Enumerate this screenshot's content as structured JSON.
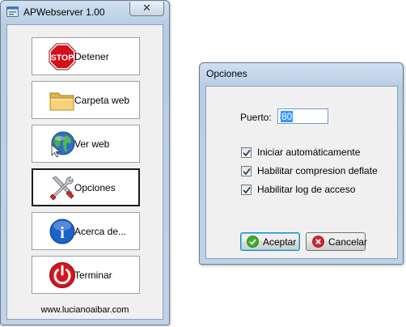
{
  "main_window": {
    "title": "APWebserver 1.00",
    "close_glyph": "✕",
    "buttons": [
      {
        "label": "Detener",
        "icon": "stop-sign-icon"
      },
      {
        "label": "Carpeta web",
        "icon": "folder-icon"
      },
      {
        "label": "Ver web",
        "icon": "globe-icon"
      },
      {
        "label": "Opciones",
        "icon": "tools-icon"
      },
      {
        "label": "Acerca de...",
        "icon": "info-icon"
      },
      {
        "label": "Terminar",
        "icon": "power-icon"
      }
    ],
    "stop_sign_text": "STOP",
    "info_glyph": "i",
    "website": "www.lucianoaibar.com"
  },
  "options_dialog": {
    "title": "Opciones",
    "port_label": "Puerto:",
    "port_value": "80",
    "checkboxes": [
      {
        "label": "Iniciar automáticamente",
        "checked": true
      },
      {
        "label": "Habilitar compresion deflate",
        "checked": true
      },
      {
        "label": "Habilitar log de acceso",
        "checked": true
      }
    ],
    "accept_label": "Aceptar",
    "cancel_label": "Cancelar"
  },
  "colors": {
    "frame": "#bfd3e8",
    "stop_red": "#d4101a",
    "globe_blue": "#2f6fc4",
    "info_blue": "#1b63c9",
    "power_red": "#d6141c",
    "accept_green": "#3fae2a",
    "cancel_red": "#d3262a"
  }
}
